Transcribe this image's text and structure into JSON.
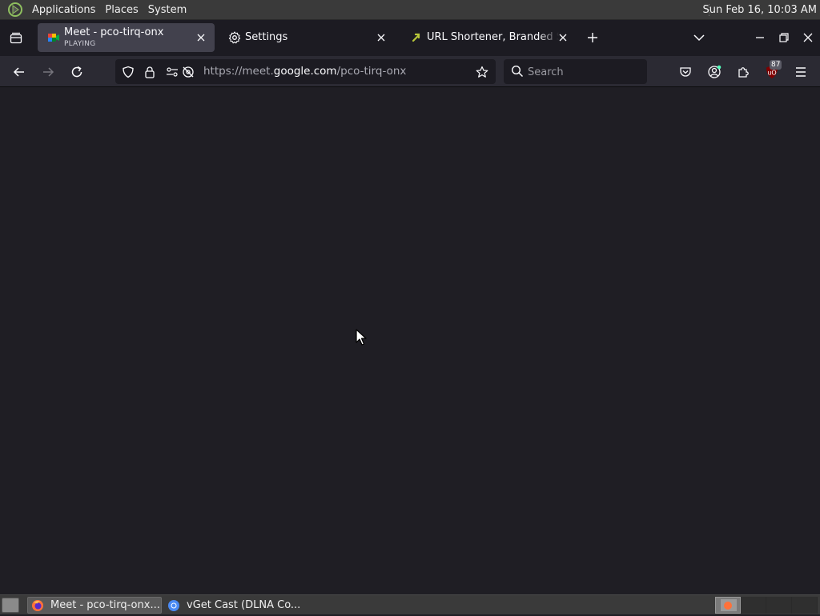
{
  "system_panel": {
    "menus": [
      "Applications",
      "Places",
      "System"
    ],
    "clock": "Sun Feb 16, 10:03 AM"
  },
  "tabs": [
    {
      "title": "Meet - pco-tirq-onx",
      "subtitle": "PLAYING",
      "active": true
    },
    {
      "title": "Settings",
      "active": false
    },
    {
      "title": "URL Shortener, Branded Short Links & Analytics",
      "active": false
    }
  ],
  "navbar": {
    "url_prefix": "https://meet.",
    "url_host": "google.com",
    "url_path": "/pco-tirq-onx",
    "search_placeholder": "Search",
    "extension_badge": "87"
  },
  "taskbar": {
    "tasks": [
      {
        "label": "Meet - pco-tirq-onx...",
        "active": true
      },
      {
        "label": "vGet Cast (DLNA Co...",
        "active": false
      }
    ],
    "workspace_count": 4,
    "active_workspace": 1
  },
  "colors": {
    "content_bg": "#1f1e24",
    "toolbar_bg": "#2b2a33",
    "tabstrip_bg": "#1c1b22",
    "active_tab_bg": "#42414d",
    "panel_bg": "#3a3a3a"
  }
}
